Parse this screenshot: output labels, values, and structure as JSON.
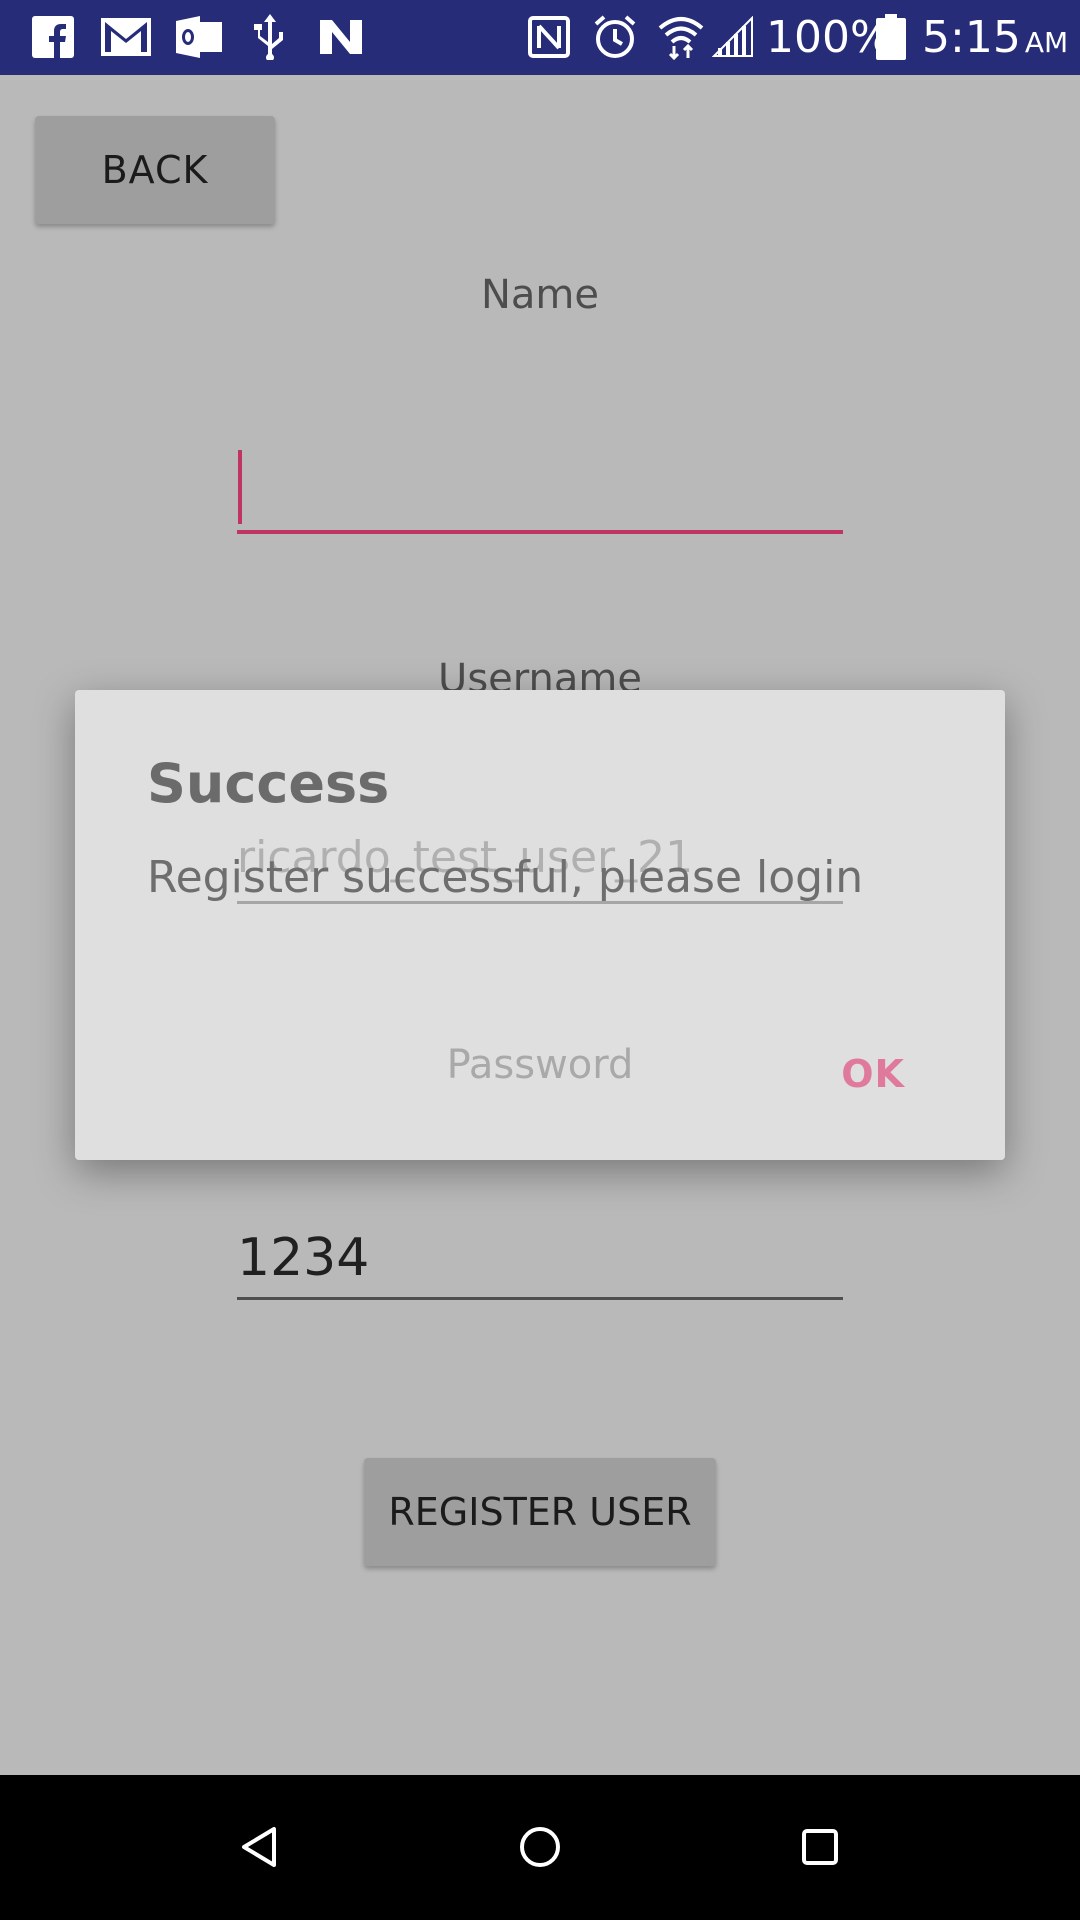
{
  "status_bar": {
    "battery_percent": "100%",
    "time": "5:15",
    "ampm": "AM",
    "icons": [
      "facebook-icon",
      "gmail-icon",
      "outlook-icon",
      "usb-icon",
      "n-icon",
      "nfc-icon",
      "alarm-icon",
      "wifi-icon",
      "signal-icon",
      "battery-icon"
    ]
  },
  "form": {
    "back_label": "BACK",
    "name_label": "Name",
    "name_value": "",
    "username_label": "Username",
    "username_value": "ricardo_test_user_21",
    "password_label": "Password",
    "password_value": "1234",
    "register_label": "REGISTER USER"
  },
  "dialog": {
    "title": "Success",
    "message": "Register successful, please login",
    "ok_label": "OK"
  },
  "nav_bar": {
    "icons": [
      "back-icon",
      "home-icon",
      "recents-icon"
    ]
  },
  "colors": {
    "status_bar": "#262c78",
    "accent": "#c03463",
    "dialog_button": "#e07a9c",
    "scrim_background": "#b9b9b9"
  }
}
